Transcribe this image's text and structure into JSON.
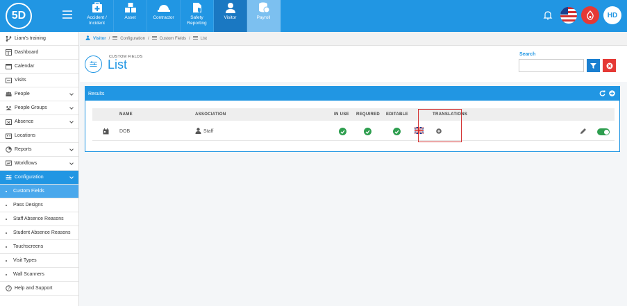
{
  "topbar": {
    "logo_text": "5D",
    "modules": [
      {
        "label": "Accident / Incident",
        "icon": "first-aid-icon"
      },
      {
        "label": "Asset",
        "icon": "boxes-icon"
      },
      {
        "label": "Contractor",
        "icon": "hard-hat-icon"
      },
      {
        "label": "Safety Reporting",
        "icon": "shield-icon"
      },
      {
        "label": "Visitor",
        "icon": "person-icon"
      },
      {
        "label": "Payroll",
        "icon": "coins-icon"
      }
    ],
    "user_initials": "HD"
  },
  "sidebar": {
    "items": [
      {
        "label": "Liam's training",
        "icon": "branch-icon"
      },
      {
        "label": "Dashboard",
        "icon": "dashboard-icon"
      },
      {
        "label": "Calendar",
        "icon": "calendar-icon"
      },
      {
        "label": "Visits",
        "icon": "visits-icon"
      },
      {
        "label": "People",
        "icon": "people-icon"
      },
      {
        "label": "People Groups",
        "icon": "people-groups-icon"
      },
      {
        "label": "Absence",
        "icon": "absence-icon"
      },
      {
        "label": "Locations",
        "icon": "locations-icon"
      },
      {
        "label": "Reports",
        "icon": "reports-icon"
      },
      {
        "label": "Workflows",
        "icon": "workflows-icon"
      },
      {
        "label": "Configuration",
        "icon": "configuration-icon"
      },
      {
        "label": "Custom Fields"
      },
      {
        "label": "Pass Designs"
      },
      {
        "label": "Staff Absence Reasons"
      },
      {
        "label": "Student Absence Reasons"
      },
      {
        "label": "Touchscreens"
      },
      {
        "label": "Visit Types"
      },
      {
        "label": "Wall Scanners"
      },
      {
        "label": "Help and Support",
        "icon": "help-icon"
      }
    ]
  },
  "breadcrumb": [
    "Visitor",
    "Configuration",
    "Custom Fields",
    "List"
  ],
  "header": {
    "small_title": "CUSTOM FIELDS",
    "title": "List",
    "search_label": "Search",
    "search_value": ""
  },
  "results": {
    "title": "Results",
    "columns": [
      "NAME",
      "ASSOCIATION",
      "IN USE",
      "REQUIRED",
      "EDITABLE",
      "TRANSLATIONS"
    ],
    "rows": [
      {
        "name": "DOB",
        "association": "Staff",
        "in_use": true,
        "required": true,
        "editable": true,
        "translations": "uk-flag",
        "enabled": true
      }
    ]
  },
  "colors": {
    "primary": "#2196e3",
    "danger": "#e53935",
    "success": "#2e9e4f",
    "highlight": "#d32f2f"
  }
}
